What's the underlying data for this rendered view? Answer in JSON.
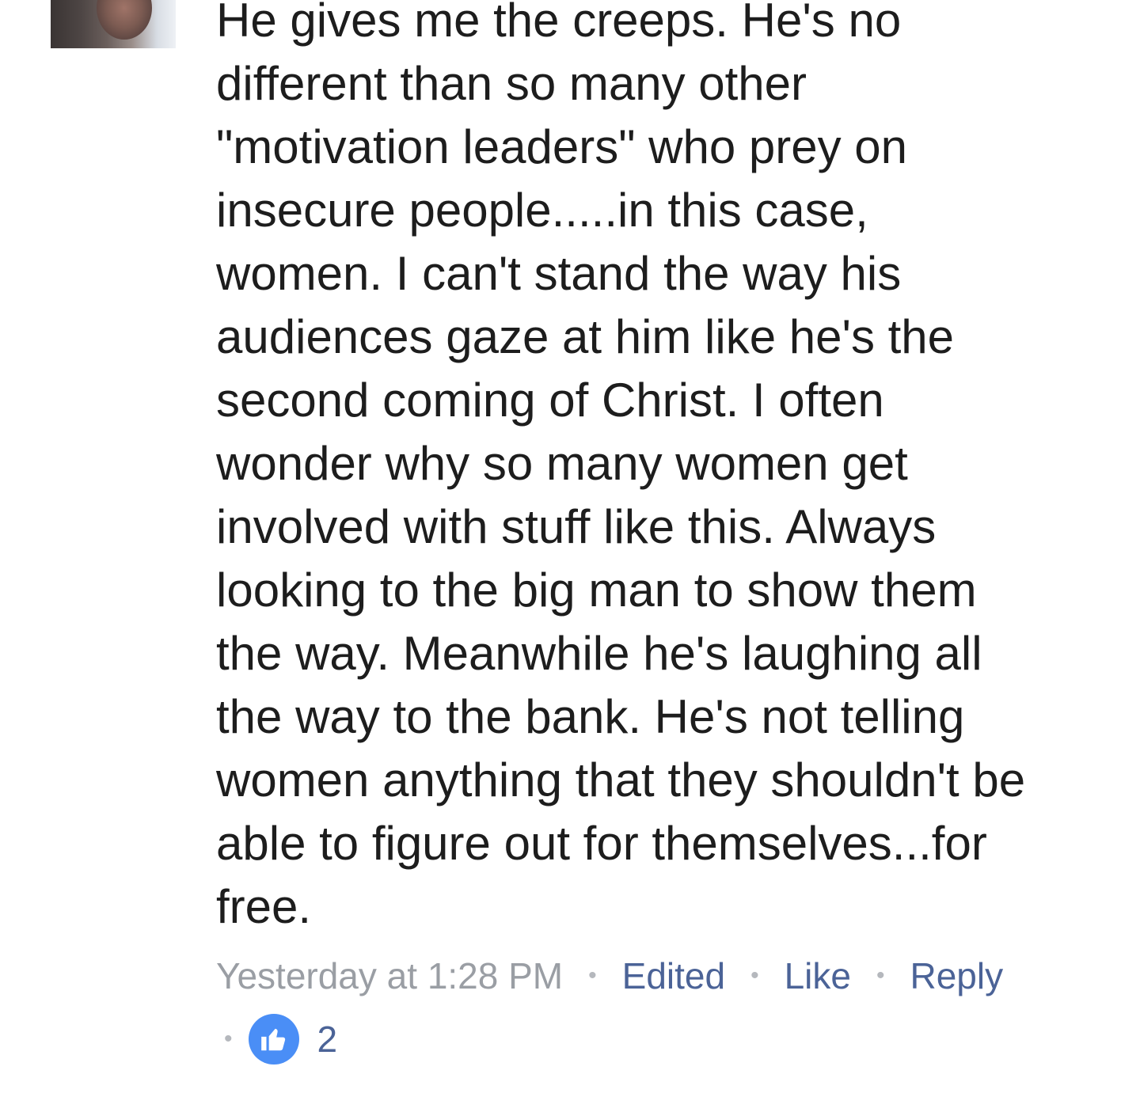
{
  "comment": {
    "text": "He gives me the creeps. He's no\ndifferent than so many other\n\"motivation leaders\" who prey on\ninsecure people.....in this case,\nwomen. I can't stand the way his\naudiences gaze at him like he's the\nsecond coming of Christ. I often\nwonder why so many women get\ninvolved with stuff like this. Always\nlooking to the big man to show them\nthe way. Meanwhile he's laughing all\nthe way to the bank. He's not telling\nwomen anything that they shouldn't be\nable to figure out for themselves...for\nfree.",
    "timestamp": "Yesterday at 1:28 PM",
    "edited_label": "Edited",
    "like_label": "Like",
    "reply_label": "Reply",
    "separator": "•",
    "reaction_count": "2"
  },
  "icons": {
    "reaction": "thumbs-up-icon"
  },
  "colors": {
    "text": "#1d1d1d",
    "timestamp": "#9a9ea4",
    "action_link": "#4b6397",
    "like_badge": "#4a8ef6"
  }
}
